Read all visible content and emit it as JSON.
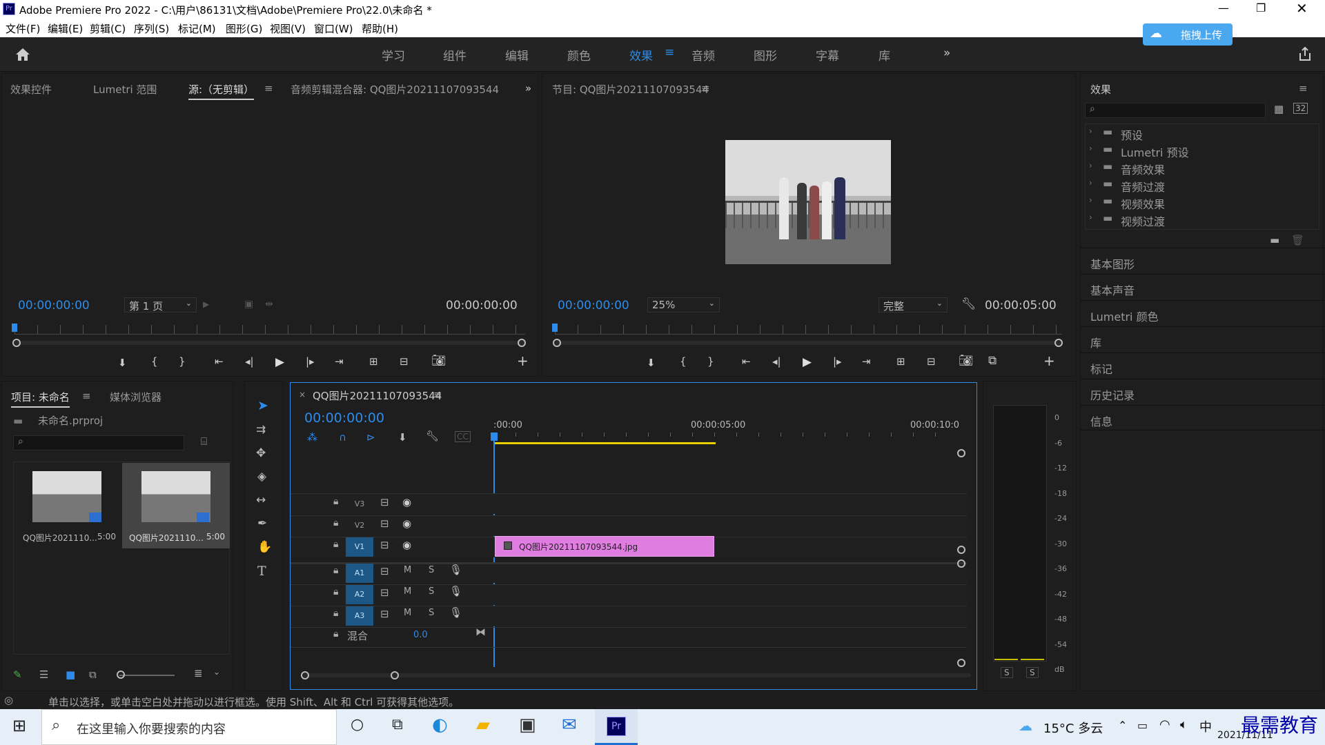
{
  "window": {
    "title": "Adobe Premiere Pro 2022 - C:\\用户\\86131\\文档\\Adobe\\Premiere Pro\\22.0\\未命名 *"
  },
  "menu": [
    "文件(F)",
    "编辑(E)",
    "剪辑(C)",
    "序列(S)",
    "标记(M)",
    "图形(G)",
    "视图(V)",
    "窗口(W)",
    "帮助(H)"
  ],
  "upload_button": "拖拽上传",
  "workspaces": [
    "学习",
    "组件",
    "编辑",
    "颜色",
    "效果",
    "音频",
    "图形",
    "字幕",
    "库"
  ],
  "active_workspace": "效果",
  "source_panel": {
    "tabs": [
      "效果控件",
      "Lumetri 范围",
      "源:（无剪辑）",
      "音频剪辑混合器: QQ图片20211107093544"
    ],
    "timecode_in": "00:00:00:00",
    "page": "第 1 页",
    "timecode_out": "00:00:00:00"
  },
  "program_panel": {
    "title": "节目: QQ图片20211107093544",
    "timecode_in": "00:00:00:00",
    "zoom": "25%",
    "quality": "完整",
    "timecode_out": "00:00:05:00"
  },
  "effects_panel": {
    "title": "效果",
    "folders": [
      "预设",
      "Lumetri 预设",
      "音频效果",
      "音频过渡",
      "视频效果",
      "视频过渡"
    ],
    "sections": [
      "基本图形",
      "基本声音",
      "Lumetri 颜色",
      "库",
      "标记",
      "历史记录",
      "信息"
    ]
  },
  "project_panel": {
    "tabs": [
      "项目: 未命名",
      "媒体浏览器"
    ],
    "file": "未命名.prproj",
    "items": [
      {
        "name": "QQ图片2021110...",
        "duration": "5:00"
      },
      {
        "name": "QQ图片2021110...",
        "duration": "5:00"
      }
    ]
  },
  "timeline": {
    "sequence": "QQ图片20211107093544",
    "timecode": "00:00:00:00",
    "ruler": [
      ":00:00",
      "00:00:05:00",
      "00:00:10:0"
    ],
    "video_tracks": [
      "V3",
      "V2",
      "V1"
    ],
    "audio_tracks": [
      "A1",
      "A2",
      "A3"
    ],
    "track_m": "M",
    "track_s": "S",
    "mix_label": "混合",
    "mix_value": "0.0",
    "clip": "QQ图片20211107093544.jpg"
  },
  "meter": {
    "ticks": [
      "0",
      "-6",
      "-12",
      "-18",
      "-24",
      "-30",
      "-36",
      "-42",
      "-48",
      "-54",
      "dB"
    ],
    "solo": [
      "S",
      "S"
    ]
  },
  "status": "单击以选择，或单击空白处并拖动以进行框选。使用 Shift、Alt 和 Ctrl 可获得其他选项。",
  "taskbar": {
    "search": "在这里输入你要搜索的内容",
    "weather": "15°C 多云",
    "ime": "中",
    "date": "2021/11/11",
    "watermark": "最需教育"
  },
  "colors": {
    "accent": "#2d8ceb",
    "clip": "#e07de0",
    "track": "#1c5786",
    "panel": "#1e1e1e"
  }
}
